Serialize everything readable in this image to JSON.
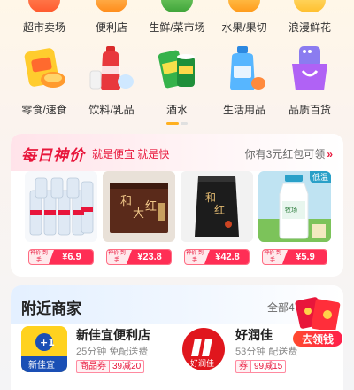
{
  "categories_row1": [
    {
      "label": "超市卖场",
      "icon": "supermarket-icon",
      "color": "#ff6a3d"
    },
    {
      "label": "便利店",
      "icon": "convenience-store-icon",
      "color": "#ff9a2e"
    },
    {
      "label": "生鲜/菜市场",
      "icon": "fresh-produce-icon",
      "color": "#55b84a"
    },
    {
      "label": "水果/果切",
      "icon": "fruit-icon",
      "color": "#ffb020"
    },
    {
      "label": "浪漫鲜花",
      "icon": "flower-icon",
      "color": "#ffd24a"
    }
  ],
  "categories_row2": [
    {
      "label": "零食/速食",
      "icon": "snacks-icon",
      "color": "#ffcc33"
    },
    {
      "label": "饮料/乳品",
      "icon": "drinks-icon",
      "color": "#e8383d"
    },
    {
      "label": "酒水",
      "icon": "beer-icon",
      "color": "#3bb54a"
    },
    {
      "label": "生活用品",
      "icon": "daily-goods-icon",
      "color": "#3aa0f0"
    },
    {
      "label": "品质百货",
      "icon": "shopping-bag-icon",
      "color": "#a55df2"
    }
  ],
  "daily": {
    "title": "每日神价",
    "slogan": "就是便宜 就是快",
    "right_text": "你有3元红包可领",
    "chevron": "»",
    "products": [
      {
        "name": "bottled-water",
        "tag_label": "神价 到手",
        "price": "¥6.9"
      },
      {
        "name": "tea-gift-box",
        "tag_label": "神价 到手",
        "price": "¥23.8"
      },
      {
        "name": "tea-pouch",
        "tag_label": "神价 到手",
        "price": "¥42.8"
      },
      {
        "name": "milk-bottle",
        "tag_label": "神价 到手",
        "price": "¥5.9",
        "badge": "低温"
      }
    ]
  },
  "nearby": {
    "title": "附近商家",
    "all_text": "全部4",
    "stores": [
      {
        "name": "新佳宜便利店",
        "meta": "25分钟  免配送费",
        "coupon_key": "商品券",
        "coupon_val": "39减20",
        "logo_text": "新佳宜"
      },
      {
        "name": "好润佳",
        "meta": "53分钟  配送费",
        "coupon_key": "券",
        "coupon_val": "99减15",
        "logo_text": "好润佳"
      }
    ],
    "redpack_button": "去领钱"
  }
}
